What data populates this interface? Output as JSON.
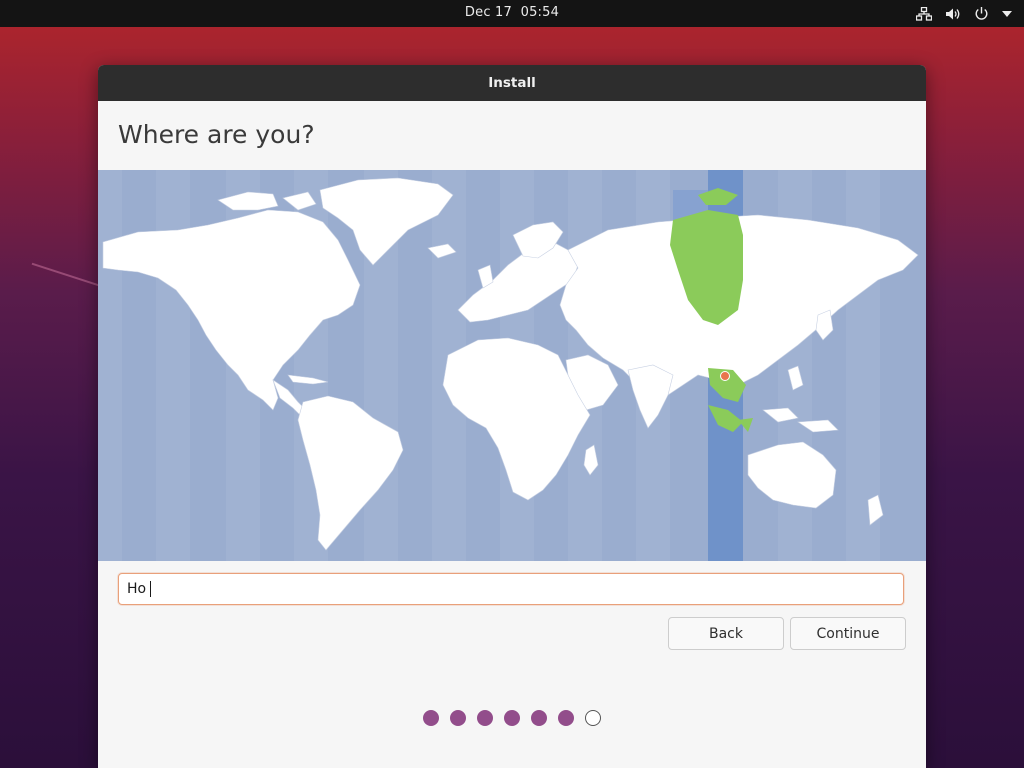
{
  "topbar": {
    "date": "Dec 17",
    "time": "05:54",
    "icons": [
      "network-icon",
      "volume-icon",
      "power-icon",
      "menu-arrow-icon"
    ]
  },
  "window": {
    "title": "Install",
    "heading": "Where are you?"
  },
  "map": {
    "selected_timezone_color": "#6f92c9",
    "highlight_region_color": "#8bcb5a",
    "marker_color": "#e8754d",
    "ocean_color": "#9aadcf",
    "land_color": "#ffffff"
  },
  "location_input": {
    "value": "Ho",
    "border_color": "#e9a07a"
  },
  "buttons": {
    "back": "Back",
    "continue": "Continue"
  },
  "progress": {
    "total_steps": 7,
    "completed_steps": 6,
    "filled_color": "#924d8b"
  }
}
